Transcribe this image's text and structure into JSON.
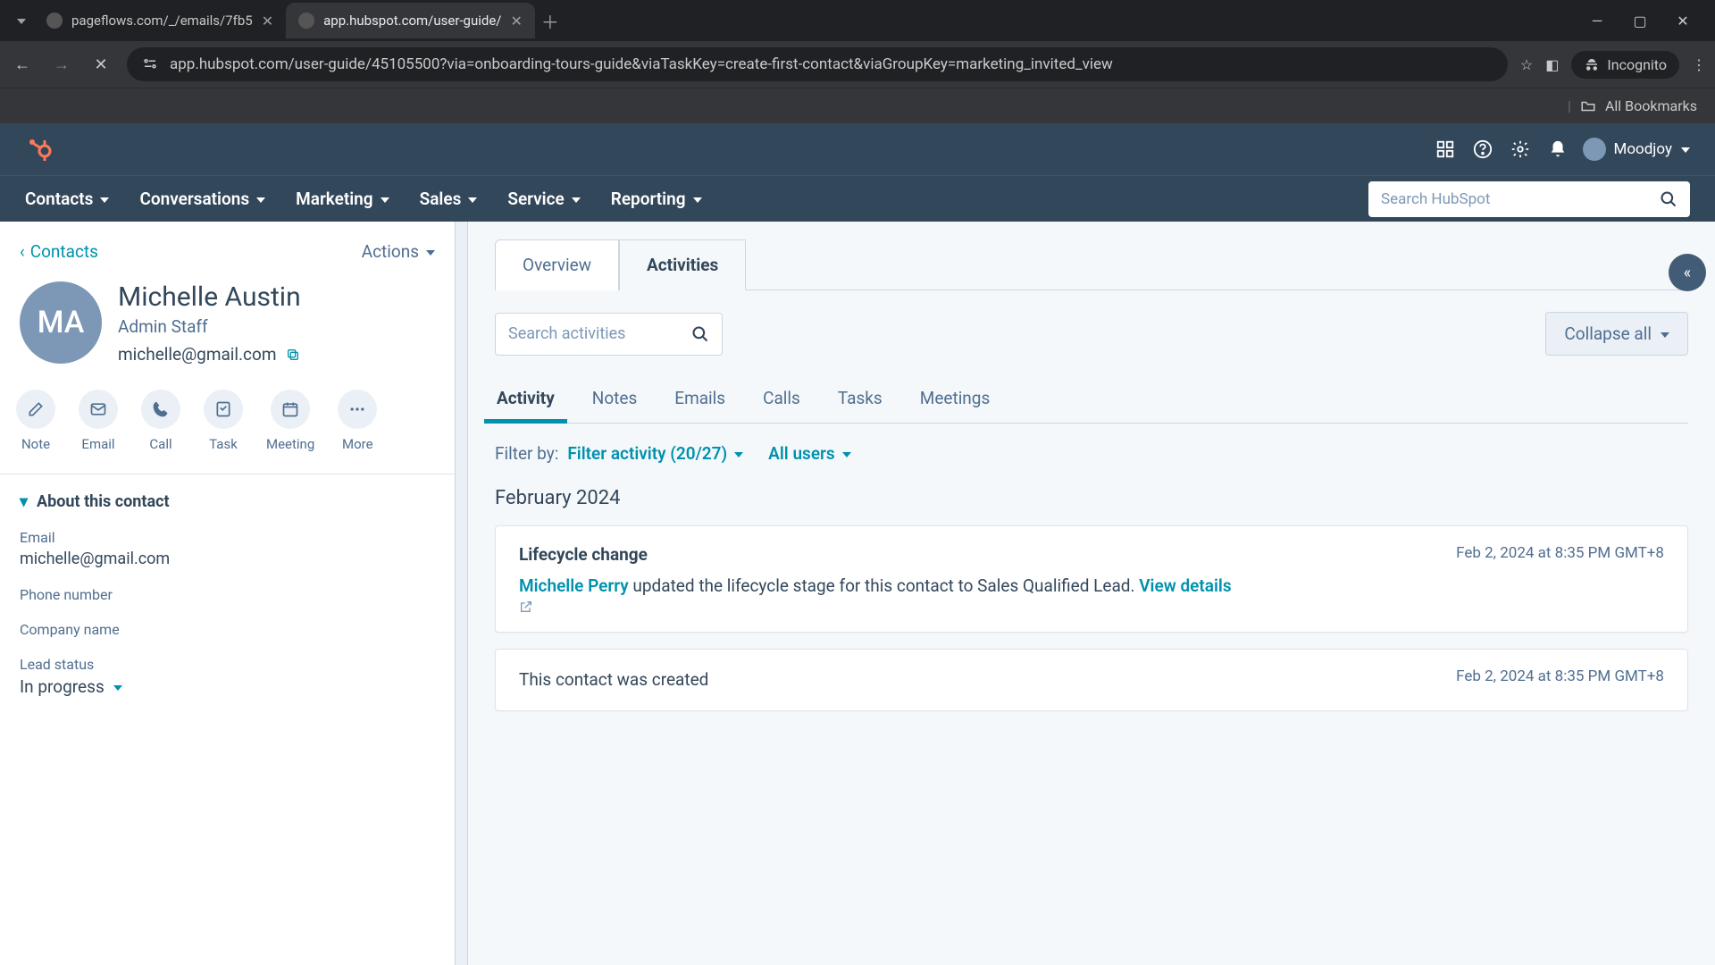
{
  "browser": {
    "tabs": [
      {
        "title": "pageflows.com/_/emails/7fb5"
      },
      {
        "title": "app.hubspot.com/user-guide/"
      }
    ],
    "url": "app.hubspot.com/user-guide/45105500?via=onboarding-tours-guide&viaTaskKey=create-first-contact&viaGroupKey=marketing_invited_view",
    "incognito": "Incognito",
    "all_bookmarks": "All Bookmarks"
  },
  "header": {
    "user": "Moodjoy",
    "search_placeholder": "Search HubSpot",
    "nav": [
      "Contacts",
      "Conversations",
      "Marketing",
      "Sales",
      "Service",
      "Reporting"
    ]
  },
  "left": {
    "back": "Contacts",
    "actions": "Actions",
    "avatar_initials": "MA",
    "name": "Michelle Austin",
    "role": "Admin Staff",
    "email": "michelle@gmail.com",
    "action_buttons": [
      "Note",
      "Email",
      "Call",
      "Task",
      "Meeting",
      "More"
    ],
    "about_title": "About this contact",
    "fields": {
      "email_label": "Email",
      "email_value": "michelle@gmail.com",
      "phone_label": "Phone number",
      "phone_value": "",
      "company_label": "Company name",
      "company_value": "",
      "lead_label": "Lead status",
      "lead_value": "In progress"
    }
  },
  "main": {
    "tabs": {
      "overview": "Overview",
      "activities": "Activities"
    },
    "search_placeholder": "Search activities",
    "collapse": "Collapse all",
    "subtabs": [
      "Activity",
      "Notes",
      "Emails",
      "Calls",
      "Tasks",
      "Meetings"
    ],
    "filter_label": "Filter by:",
    "filter_activity": "Filter activity (20/27)",
    "filter_users": "All users",
    "month": "February 2024",
    "cards": [
      {
        "title": "Lifecycle change",
        "time": "Feb 2, 2024 at 8:35 PM GMT+8",
        "actor": "Michelle Perry",
        "rest": " updated the lifecycle stage for this contact to Sales Qualified Lead. ",
        "view": "View details"
      },
      {
        "title": "",
        "time": "Feb 2, 2024 at 8:35 PM GMT+8",
        "plain": "This contact was created"
      }
    ]
  }
}
